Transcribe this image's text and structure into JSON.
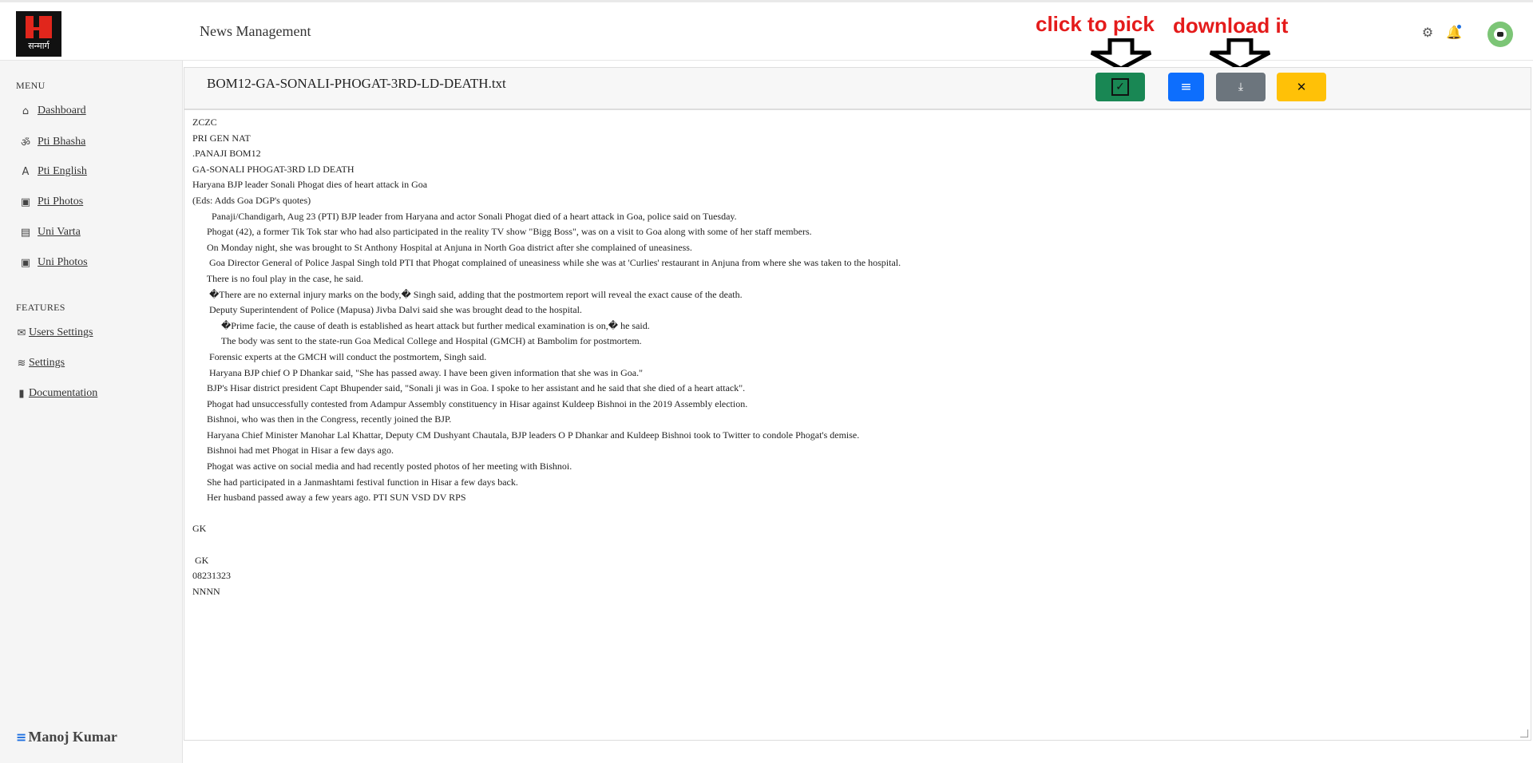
{
  "header": {
    "logo_text": "सन्मार्ग",
    "app_title": "News Management",
    "settings_icon": "gear-icon",
    "notification_icon": "bell-icon",
    "avatar_icon": "avatar-icon"
  },
  "sidebar": {
    "menu_heading": "MENU",
    "menu_items": [
      {
        "label": "Dashboard",
        "icon": "home-icon"
      },
      {
        "label": "Pti Bhasha",
        "icon": "om-icon"
      },
      {
        "label": "Pti English",
        "icon": "letter-a-icon"
      },
      {
        "label": "Pti Photos",
        "icon": "image-icon"
      },
      {
        "label": "Uni Varta",
        "icon": "document-icon"
      },
      {
        "label": "Uni Photos",
        "icon": "image-icon"
      }
    ],
    "features_heading": "FEATURES",
    "feature_items": [
      {
        "label": "Users Settings",
        "icon": "envelope-icon"
      },
      {
        "label": "Settings",
        "icon": "layers-icon"
      },
      {
        "label": "Documentation",
        "icon": "file-icon"
      }
    ],
    "user_name": "Manoj Kumar"
  },
  "panel": {
    "file_name": "BOM12-GA-SONALI-PHOGAT-3RD-LD-DEATH.txt",
    "buttons": {
      "pick_icon": "check-square-icon",
      "list_icon": "list-icon",
      "download_icon": "download-icon",
      "close_icon": "close-icon"
    },
    "annotations": {
      "pick": "click to pick",
      "download": "download it"
    },
    "content_lines": [
      "ZCZC",
      "PRI GEN NAT",
      ".PANAJI BOM12",
      "GA-SONALI PHOGAT-3RD LD DEATH",
      "Haryana BJP leader Sonali Phogat dies of heart attack in Goa",
      "(Eds: Adds Goa DGP's quotes)",
      "        Panaji/Chandigarh, Aug 23 (PTI) BJP leader from Haryana and actor Sonali Phogat died of a heart attack in Goa, police said on Tuesday.",
      "      Phogat (42), a former Tik Tok star who had also participated in the reality TV show \"Bigg Boss\", was on a visit to Goa along with some of her staff members.",
      "      On Monday night, she was brought to St Anthony Hospital at Anjuna in North Goa district after she complained of uneasiness.",
      "       Goa Director General of Police Jaspal Singh told PTI that Phogat complained of uneasiness while she was at 'Curlies' restaurant in Anjuna from where she was taken to the hospital.",
      "      There is no foul play in the case, he said.",
      "       �There are no external injury marks on the body,� Singh said, adding that the postmortem report will reveal the exact cause of the death.",
      "       Deputy Superintendent of Police (Mapusa) Jivba Dalvi said she was brought dead to the hospital.",
      "            �Prime facie, the cause of death is established as heart attack but further medical examination is on,� he said.",
      "            The body was sent to the state-run Goa Medical College and Hospital (GMCH) at Bambolim for postmortem.",
      "       Forensic experts at the GMCH will conduct the postmortem, Singh said.",
      "       Haryana BJP chief O P Dhankar said, \"She has passed away. I have been given information that she was in Goa.\"",
      "      BJP's Hisar district president Capt Bhupender said, \"Sonali ji was in Goa. I spoke to her assistant and he said that she died of a heart attack\".",
      "      Phogat had unsuccessfully contested from Adampur Assembly constituency in Hisar against Kuldeep Bishnoi in the 2019 Assembly election.",
      "      Bishnoi, who was then in the Congress, recently joined the BJP.",
      "      Haryana Chief Minister Manohar Lal Khattar, Deputy CM Dushyant Chautala, BJP leaders O P Dhankar and Kuldeep Bishnoi took to Twitter to condole Phogat's demise.",
      "      Bishnoi had met Phogat in Hisar a few days ago.",
      "      Phogat was active on social media and had recently posted photos of her meeting with Bishnoi.",
      "      She had participated in a Janmashtami festival function in Hisar a few days back.",
      "      Her husband passed away a few years ago. PTI SUN VSD DV RPS",
      "",
      "GK",
      "",
      " GK",
      "08231323",
      "NNNN"
    ]
  }
}
